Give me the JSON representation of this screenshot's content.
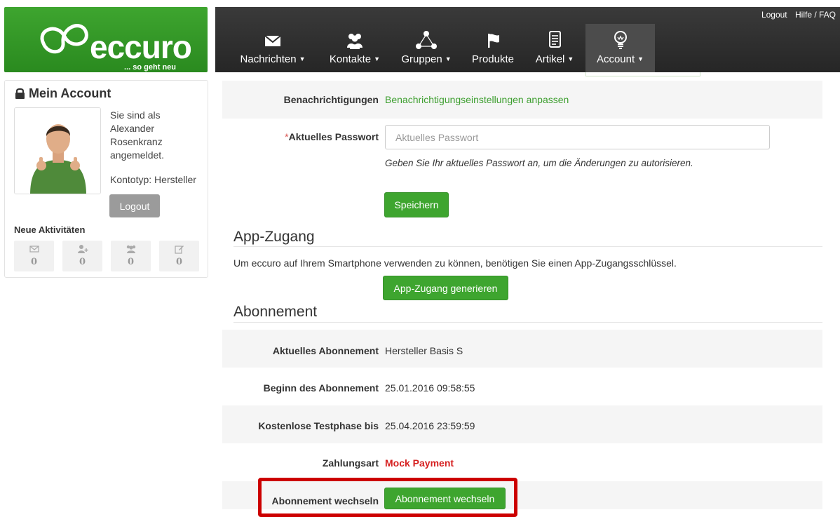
{
  "logo": {
    "brand": "eccuro",
    "tagline": "... so geht neu"
  },
  "top_links": {
    "logout": "Logout",
    "help": "Hilfe / FAQ"
  },
  "nav": [
    {
      "label": "Nachrichten",
      "icon": "envelope-icon",
      "dropdown": true
    },
    {
      "label": "Kontakte",
      "icon": "users-icon",
      "dropdown": true
    },
    {
      "label": "Gruppen",
      "icon": "group-network-icon",
      "dropdown": true
    },
    {
      "label": "Produkte",
      "icon": "flag-icon",
      "dropdown": false
    },
    {
      "label": "Artikel",
      "icon": "document-icon",
      "dropdown": true
    },
    {
      "label": "Account",
      "icon": "lightbulb-icon",
      "dropdown": true,
      "active": true
    }
  ],
  "sidebar": {
    "title": "Mein Account",
    "login_line1": "Sie sind als",
    "login_line2": "Alexander",
    "login_line3": "Rosenkranz",
    "login_line4": "angemeldet.",
    "account_type": "Kontotyp: Hersteller",
    "logout_label": "Logout",
    "activities_title": "Neue Aktivitäten",
    "activities": [
      {
        "icon": "envelope-outline-icon",
        "count": "0"
      },
      {
        "icon": "add-user-icon",
        "count": "0"
      },
      {
        "icon": "group-icon",
        "count": "0"
      },
      {
        "icon": "edit-icon",
        "count": "0"
      }
    ]
  },
  "form": {
    "notifications_label": "Benachrichtigungen",
    "notifications_link": "Benachrichtigungseinstellungen anpassen",
    "password_required_mark": "*",
    "password_label": "Aktuelles Passwort",
    "password_placeholder": "Aktuelles Passwort",
    "password_help": "Geben Sie Ihr aktuelles Passwort an, um die Änderungen zu autorisieren.",
    "save_label": "Speichern"
  },
  "app_access": {
    "heading": "App-Zugang",
    "description": "Um eccuro auf Ihrem Smartphone verwenden zu können, benötigen Sie einen App-Zugangsschlüssel.",
    "button_label": "App-Zugang generieren"
  },
  "subscription": {
    "heading": "Abonnement",
    "current_label": "Aktuelles Abonnement",
    "current_value": "Hersteller Basis S",
    "start_label": "Beginn des Abonnement",
    "start_value": "25.01.2016 09:58:55",
    "trial_label": "Kostenlose Testphase bis",
    "trial_value": "25.04.2016 23:59:59",
    "payment_label": "Zahlungsart",
    "payment_value": "Mock Payment",
    "payment_color": "#d62020",
    "change_label": "Abonnement wechseln",
    "change_button": "Abonnement wechseln"
  },
  "colors": {
    "brand_green": "#3ea52f",
    "navbar": "#2b2b2b",
    "highlight": "#cc0000"
  }
}
